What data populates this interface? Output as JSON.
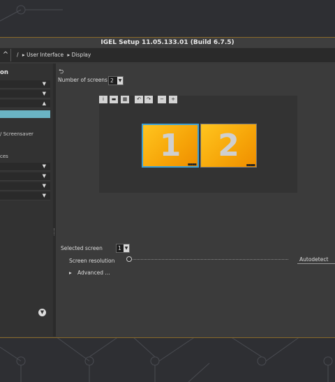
{
  "window": {
    "title": "IGEL Setup 11.05.133.01 (Build 6.7.5)"
  },
  "toolbar": {
    "nav_glyph": "^",
    "breadcrumb": [
      {
        "sep": "/"
      },
      {
        "label": "▸ User Interface"
      },
      {
        "label": "▸ Display"
      }
    ]
  },
  "sidebar": {
    "heading": "on",
    "rows": [
      {
        "arrow": "▼"
      },
      {
        "arrow": "▼"
      },
      {
        "arrow": "▲"
      }
    ],
    "text_items": [
      "/ Screensaver",
      "ces"
    ],
    "rows_lower": [
      {
        "arrow": "▼"
      },
      {
        "arrow": "▼"
      },
      {
        "arrow": "▼"
      },
      {
        "arrow": "▼"
      }
    ],
    "bottom_button": "▼"
  },
  "main": {
    "section_icon": "⮌",
    "number_of_screens": {
      "label": "Number of screens",
      "value": "2"
    },
    "preview_toolbar": [
      "i",
      "▬",
      "▦",
      "↶",
      "↷",
      "−",
      "+"
    ],
    "monitors": [
      {
        "number": "1",
        "selected": true
      },
      {
        "number": "2",
        "selected": false
      }
    ],
    "selected_screen": {
      "label": "Selected screen",
      "value": "1"
    },
    "screen_resolution": {
      "label": "Screen resolution",
      "value": "Autodetect",
      "slider_position": 0
    },
    "advanced": {
      "label": "Advanced ..."
    }
  },
  "colors": {
    "accent_selection": "#6ab4c4",
    "monitor_fill": "#f6a408",
    "monitor_selected_border": "#3aa0d8",
    "window_border": "#8a6a2a"
  }
}
